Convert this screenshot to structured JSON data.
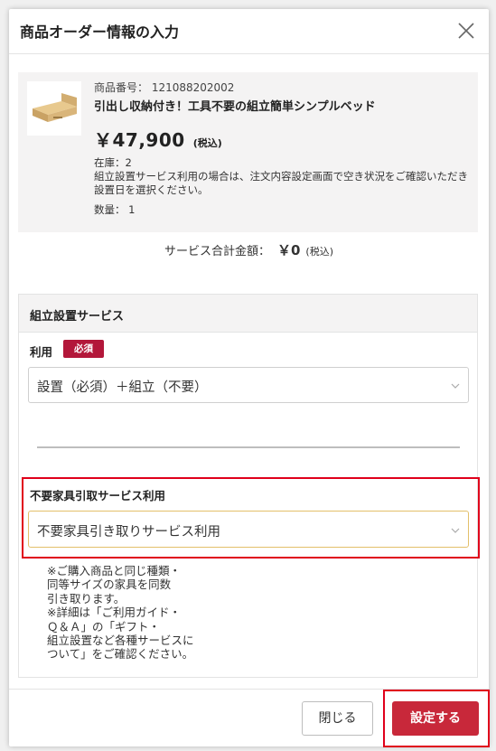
{
  "modal": {
    "title": "商品オーダー情報の入力"
  },
  "product": {
    "sku_label": "商品番号： 121088202002",
    "name": "引出し収納付き！工具不要の組立簡単シンプルベッド",
    "price": "￥47,900",
    "tax_label": "(税込)",
    "stock": "在庫：2",
    "note": "組立設置サービス利用の場合は、注文内容設定画面で空き状況をご確認いただき設置日を選択ください。",
    "quantity": "数量： 1"
  },
  "total": {
    "label": "サービス合計金額：",
    "amount": "￥0",
    "tax_label": "(税込)"
  },
  "service": {
    "heading": "組立設置サービス",
    "use_label": "利用",
    "required_badge": "必須",
    "assembly_select_value": "設置（必須）＋組立（不要）",
    "furniture_label": "不要家具引取サービス利用",
    "furniture_select_value": "不要家具引き取りサービス利用",
    "description": [
      "※ご購入商品と同じ種類・",
      "同等サイズの家具を同数",
      "引き取ります。",
      "※詳細は「ご利用ガイド・",
      "Ｑ＆Ａ」の「ギフト・",
      "組立設置など各種サービスに",
      "ついて」をご確認ください。"
    ]
  },
  "footer": {
    "close_label": "閉じる",
    "submit_label": "設定する"
  },
  "colors": {
    "accent": "#c8283a",
    "badge": "#b3173a",
    "highlight": "#e0001b"
  }
}
